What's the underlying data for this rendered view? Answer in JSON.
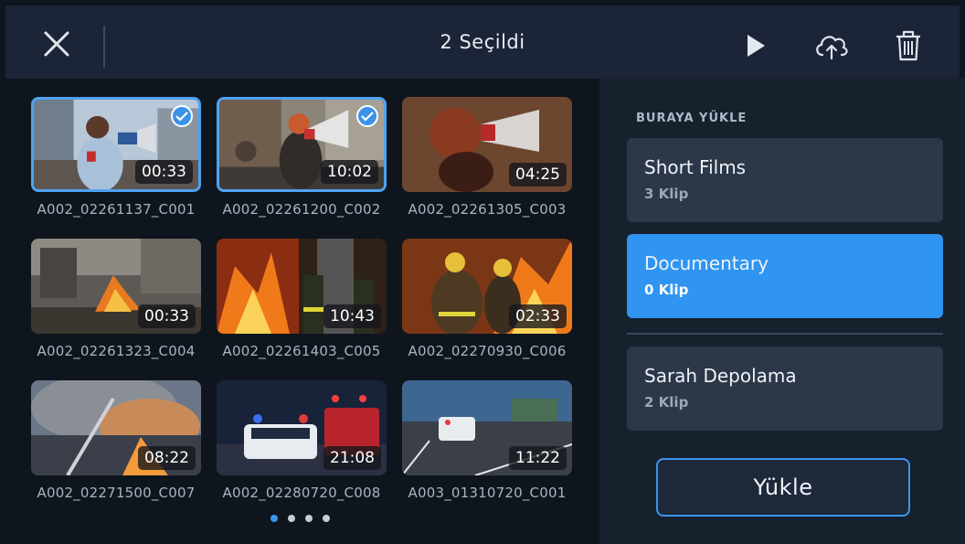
{
  "header": {
    "title": "2 Seçildi",
    "icons": [
      "close-icon",
      "play-icon",
      "cloud-upload-icon",
      "trash-icon"
    ]
  },
  "clips": [
    {
      "name": "A002_02261137_C001",
      "duration": "00:33",
      "selected": true
    },
    {
      "name": "A002_02261200_C002",
      "duration": "10:02",
      "selected": true
    },
    {
      "name": "A002_02261305_C003",
      "duration": "04:25",
      "selected": false
    },
    {
      "name": "A002_02261323_C004",
      "duration": "00:33",
      "selected": false
    },
    {
      "name": "A002_02261403_C005",
      "duration": "10:43",
      "selected": false
    },
    {
      "name": "A002_02270930_C006",
      "duration": "02:33",
      "selected": false
    },
    {
      "name": "A002_02271500_C007",
      "duration": "08:22",
      "selected": false
    },
    {
      "name": "A002_02280720_C008",
      "duration": "21:08",
      "selected": false
    },
    {
      "name": "A003_01310720_C001",
      "duration": "11:22",
      "selected": false
    }
  ],
  "pagination": {
    "pages": 4,
    "current": 1
  },
  "upload_panel": {
    "section_label": "BURAYA YÜKLE",
    "destinations": [
      {
        "name": "Short Films",
        "count": "3 Klip",
        "active": false
      },
      {
        "name": "Documentary",
        "count": "0 Klip",
        "active": true
      },
      {
        "name": "Sarah Depolama",
        "count": "2 Klip",
        "active": false
      }
    ],
    "upload_label": "Yükle"
  },
  "colors": {
    "accent": "#2f95f1",
    "selection": "#4ea2f2",
    "background": "#10161f"
  }
}
